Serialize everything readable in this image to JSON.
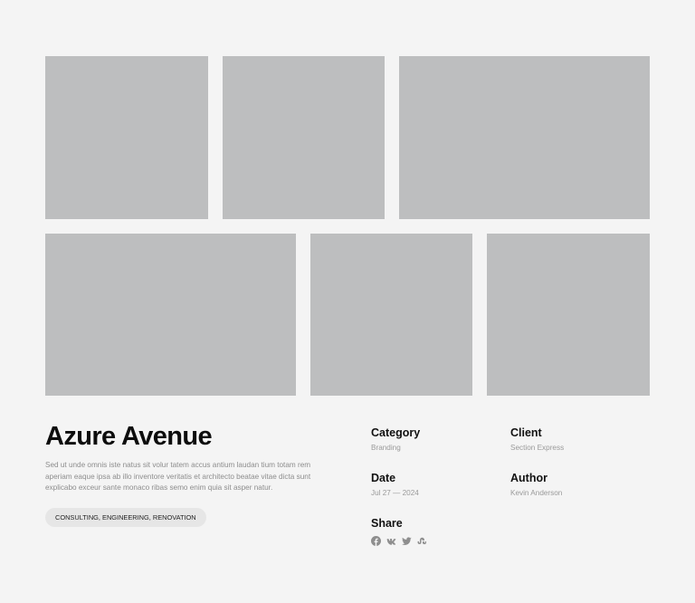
{
  "gallery": {
    "tiles": [
      "image-1",
      "image-2",
      "image-3",
      "image-4",
      "image-5",
      "image-6"
    ],
    "placeholder_color": "#bdbebf"
  },
  "project": {
    "title": "Azure Avenue",
    "description": "Sed ut unde omnis iste natus sit volur tatem accus antium laudan tium totam rem aperiam eaque ipsa ab illo inventore veritatis et architecto beatae vitae dicta sunt explicabo exceur sante monaco ribas semo enim quia sit asper natur.",
    "tags": "CONSULTING, ENGINEERING, RENOVATION"
  },
  "meta": {
    "category": {
      "label": "Category",
      "value": "Branding"
    },
    "client": {
      "label": "Client",
      "value": "Section Express"
    },
    "date": {
      "label": "Date",
      "value": "Jul 27 — 2024"
    },
    "author": {
      "label": "Author",
      "value": "Kevin Anderson"
    },
    "share": {
      "label": "Share",
      "icons": [
        "facebook-icon",
        "vk-icon",
        "twitter-icon",
        "stumbleupon-icon"
      ],
      "icon_color": "#8e8e8e"
    }
  },
  "colors": {
    "background": "#f4f4f4",
    "heading": "#0d0d0d",
    "muted_text": "#9a9a9a",
    "tag_background": "#e6e6e6"
  }
}
